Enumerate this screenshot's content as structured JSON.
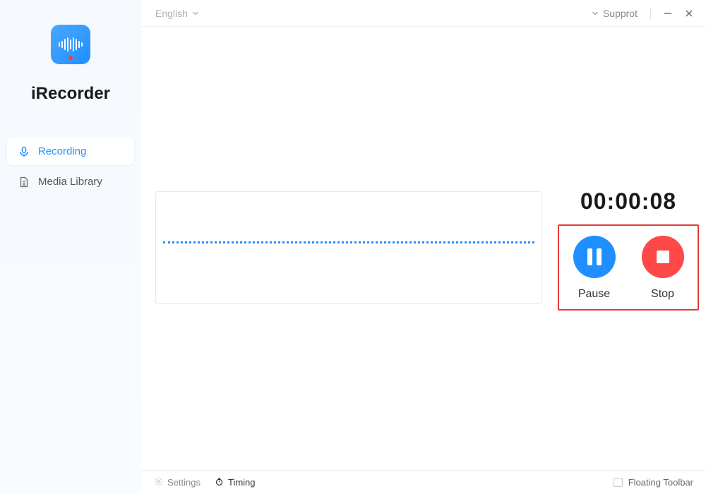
{
  "app": {
    "name": "iRecorder"
  },
  "titlebar": {
    "language": "English",
    "support": "Supprot"
  },
  "sidebar": {
    "items": [
      {
        "label": "Recording",
        "active": true,
        "icon": "microphone-icon"
      },
      {
        "label": "Media Library",
        "active": false,
        "icon": "document-icon"
      }
    ]
  },
  "recording": {
    "timer": "00:00:08",
    "pause_label": "Pause",
    "stop_label": "Stop"
  },
  "statusbar": {
    "settings_label": "Settings",
    "timing_label": "Timing",
    "floating_toolbar_label": "Floating Toolbar",
    "floating_toolbar_checked": false
  },
  "colors": {
    "accent": "#1f8fff",
    "danger": "#ff4848",
    "highlight_border": "#e53935"
  }
}
